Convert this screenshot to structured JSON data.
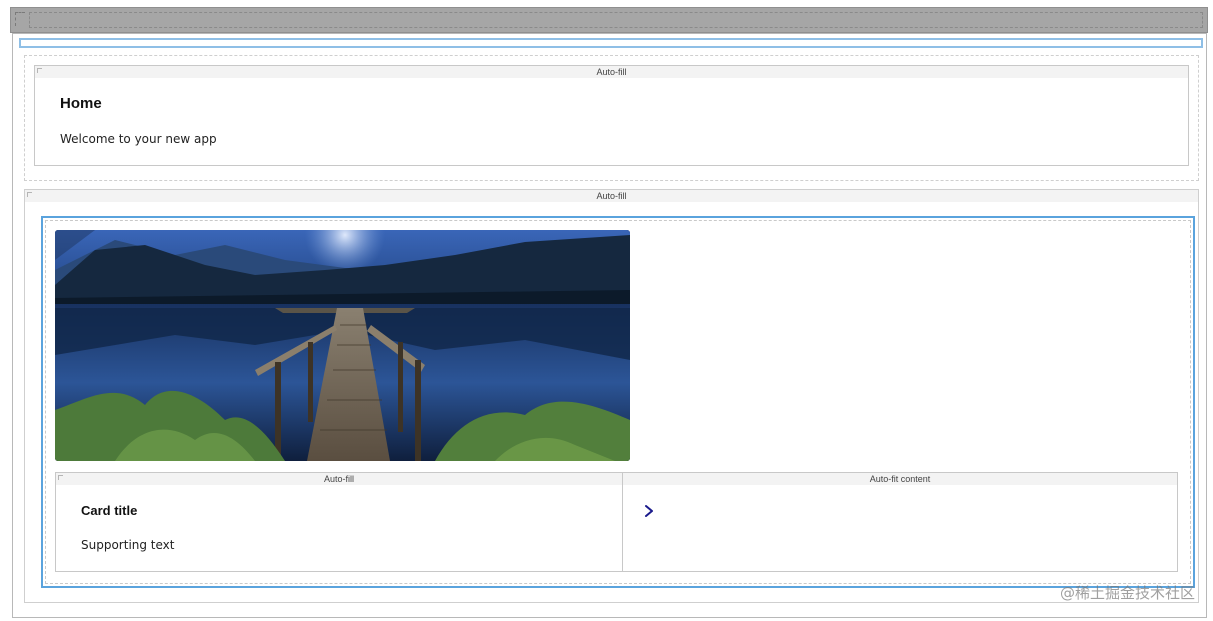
{
  "home": {
    "container_label": "Auto-fill",
    "title": "Home",
    "subtitle": "Welcome to your new app"
  },
  "content": {
    "container_label": "Auto-fill",
    "image_subject": "moonlit lake with wooden dock and forested mountains",
    "card_row": {
      "left_label": "Auto-fill",
      "right_label": "Auto-fit content",
      "card_title": "Card title",
      "supporting_text": "Supporting text",
      "chevron_icon": "chevron-right-icon"
    }
  },
  "watermark": "@稀土掘金技术社区",
  "colors": {
    "selection_blue": "#5aa3dd",
    "chevron": "#1a1a8c",
    "top_bar": "#a6a6a6"
  }
}
